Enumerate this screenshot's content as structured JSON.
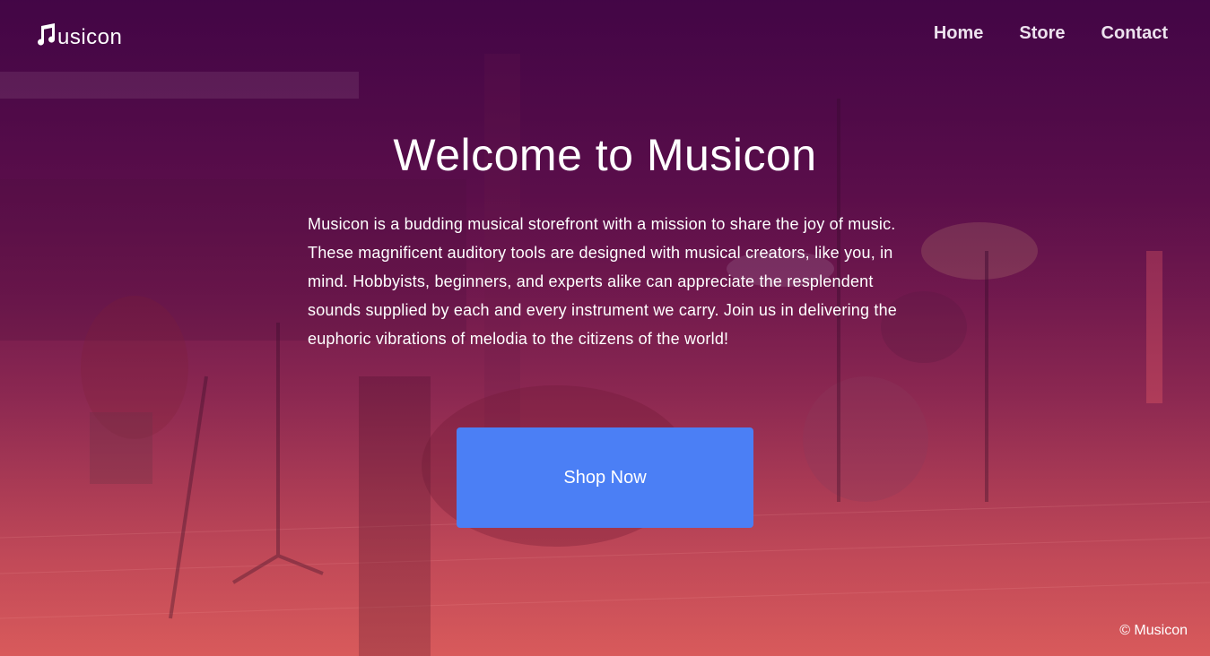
{
  "brand": {
    "logo_text": "usicon",
    "logo_icon": "music-note-icon"
  },
  "nav": {
    "items": [
      {
        "label": "Home"
      },
      {
        "label": "Store"
      },
      {
        "label": "Contact"
      }
    ]
  },
  "hero": {
    "title": "Welcome to Musicon",
    "description": "Musicon is a budding musical storefront with a mission to share the joy of music. These magnificent auditory tools are designed with musical creators, like you, in mind. Hobbyists, beginners, and experts alike can appreciate the resplendent sounds supplied by each and every instrument we carry. Join us in delivering the euphoric vibrations of melodia to the citizens of the world!",
    "cta_label": "Shop Now"
  },
  "footer": {
    "copyright": "© Musicon"
  },
  "colors": {
    "button": "#4b7ff5",
    "gradient_top": "#3f0644",
    "gradient_bottom": "#d45a5c"
  }
}
